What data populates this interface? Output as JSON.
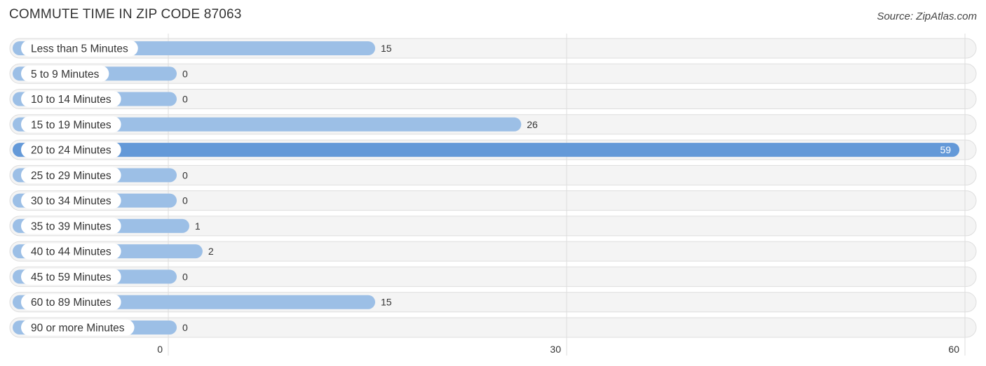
{
  "header": {
    "title": "COMMUTE TIME IN ZIP CODE 87063",
    "source": "Source: ZipAtlas.com"
  },
  "chart_data": {
    "type": "bar",
    "orientation": "horizontal",
    "title": "COMMUTE TIME IN ZIP CODE 87063",
    "xlabel": "",
    "ylabel": "",
    "categories": [
      "Less than 5 Minutes",
      "5 to 9 Minutes",
      "10 to 14 Minutes",
      "15 to 19 Minutes",
      "20 to 24 Minutes",
      "25 to 29 Minutes",
      "30 to 34 Minutes",
      "35 to 39 Minutes",
      "40 to 44 Minutes",
      "45 to 59 Minutes",
      "60 to 89 Minutes",
      "90 or more Minutes"
    ],
    "values": [
      15,
      0,
      0,
      26,
      59,
      0,
      0,
      1,
      2,
      0,
      15,
      0
    ],
    "value_labels": [
      "15",
      "0",
      "0",
      "26",
      "59",
      "0",
      "0",
      "1",
      "2",
      "0",
      "15",
      "0"
    ],
    "xlim": [
      0,
      60
    ],
    "xticks": [
      0,
      30,
      60
    ],
    "xtick_labels": [
      "0",
      "30",
      "60"
    ],
    "grid": true,
    "highlight_index": 4,
    "colors": {
      "bar": "#9cbfe6",
      "bar_highlight": "#6499d8",
      "row_background": "#f4f4f4",
      "grid": "#dddddd",
      "text": "#333333"
    }
  }
}
